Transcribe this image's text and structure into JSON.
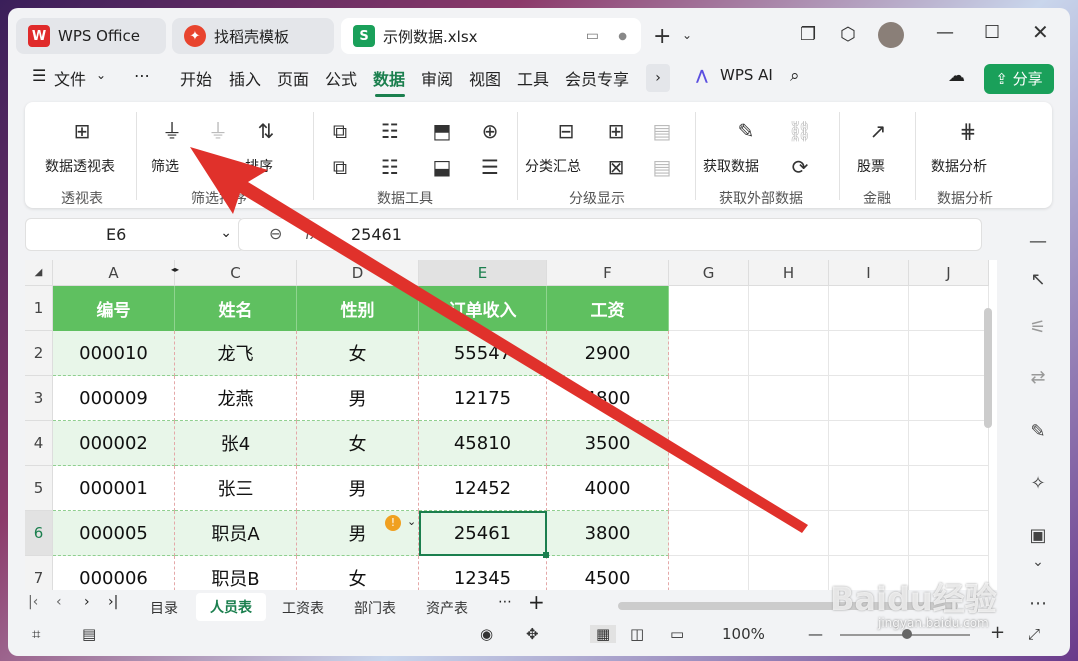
{
  "tabs": {
    "wps": "WPS Office",
    "template": "找稻壳模板",
    "file": "示例数据.xlsx"
  },
  "menu": {
    "file": "文件",
    "more": "⋯",
    "items": [
      "开始",
      "插入",
      "页面",
      "公式",
      "数据",
      "审阅",
      "视图",
      "工具",
      "会员专享"
    ],
    "wps_ai": "WPS AI",
    "share": "分享"
  },
  "ribbon": {
    "pivot_label": "数据透视表",
    "pivot_group": "透视表",
    "filter_label": "筛选",
    "sort_label": "排序",
    "sort_group": "筛选排序",
    "tools_group": "数据工具",
    "subtotal_label": "分类汇总",
    "outline_group": "分级显示",
    "getdata_label": "获取数据",
    "external_group": "获取外部数据",
    "stock_label": "股票",
    "finance_group": "金融",
    "analysis_label": "数据分析",
    "analysis_group": "数据分析"
  },
  "namebox": "E6",
  "formula": "25461",
  "columns": [
    "A",
    "B",
    "C",
    "D",
    "E",
    "F",
    "G",
    "H",
    "I",
    "J"
  ],
  "rows": [
    "1",
    "2",
    "3",
    "4",
    "5",
    "6",
    "7"
  ],
  "headers": [
    "编号",
    "姓名",
    "性别",
    "订单收入",
    "工资"
  ],
  "data": [
    [
      "000010",
      "龙飞",
      "女",
      "55547",
      "2900"
    ],
    [
      "000009",
      "龙燕",
      "男",
      "12175",
      "4800"
    ],
    [
      "000002",
      "张4",
      "女",
      "45810",
      "3500"
    ],
    [
      "000001",
      "张三",
      "男",
      "12452",
      "4000"
    ],
    [
      "000005",
      "职员A",
      "男",
      "25461",
      "3800"
    ],
    [
      "000006",
      "职员B",
      "女",
      "12345",
      "4500"
    ]
  ],
  "sheets": [
    "目录",
    "人员表",
    "工资表",
    "部门表",
    "资产表"
  ],
  "zoom": "100%",
  "watermark": "Baidu经验",
  "watermark_url": "jingyan.baidu.com",
  "colors": {
    "accent": "#1b7f4e",
    "header_fill": "#5fc060",
    "band_fill": "#e8f6e9",
    "arrow": "#e0312b"
  }
}
